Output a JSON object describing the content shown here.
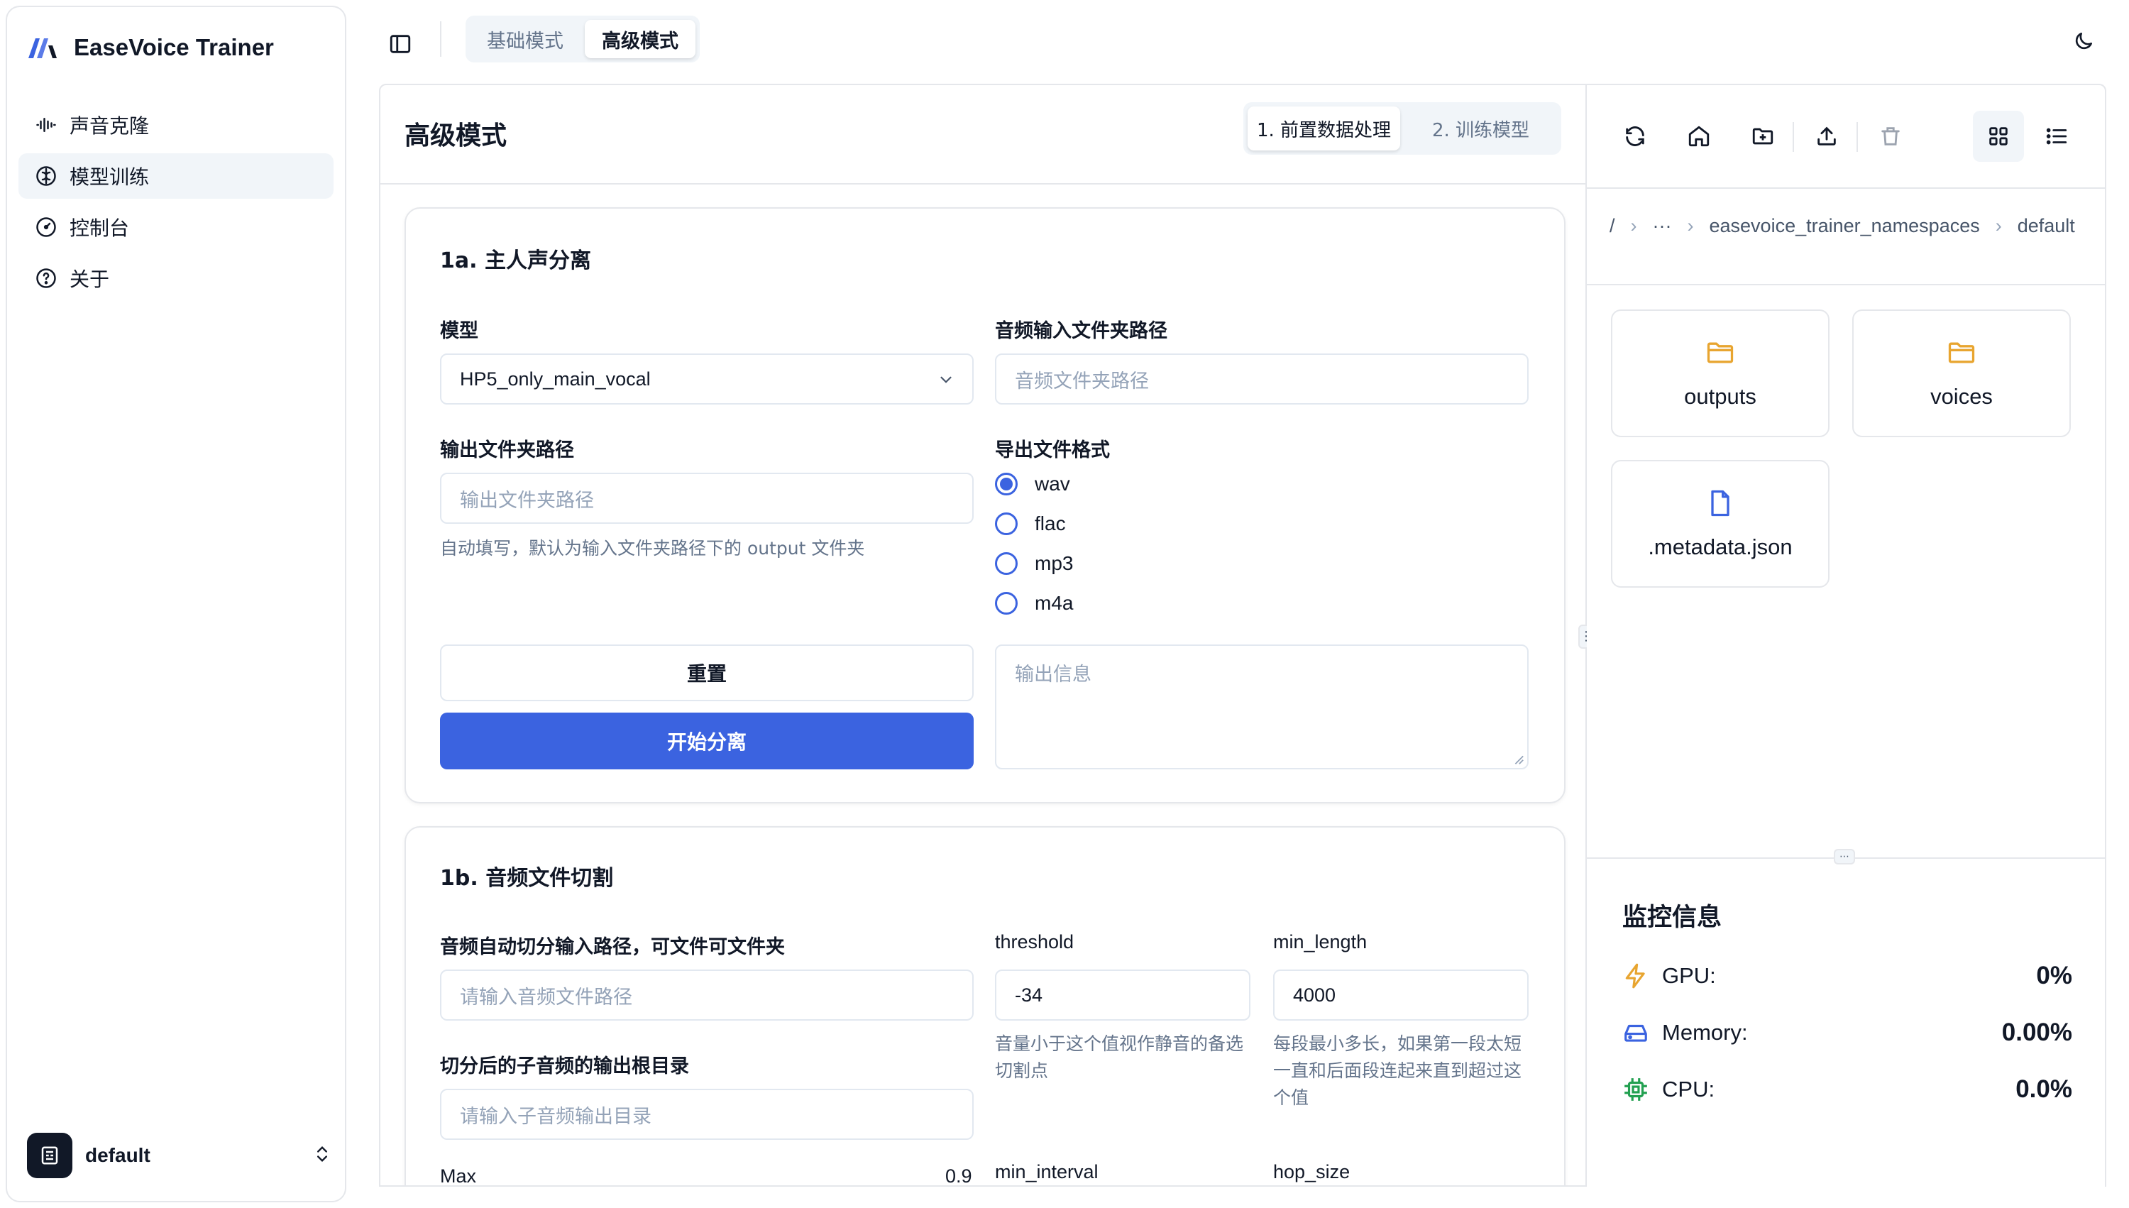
{
  "app": {
    "name": "EaseVoice Trainer"
  },
  "sidebar": {
    "items": [
      {
        "label": "声音克隆",
        "icon": "audio-waveform-icon",
        "active": false
      },
      {
        "label": "模型训练",
        "icon": "brain-icon",
        "active": true
      },
      {
        "label": "控制台",
        "icon": "gauge-icon",
        "active": false
      },
      {
        "label": "关于",
        "icon": "help-circle-icon",
        "active": false
      }
    ],
    "namespace": "default"
  },
  "topbar": {
    "mode_tabs": [
      {
        "label": "基础模式",
        "active": false
      },
      {
        "label": "高级模式",
        "active": true
      }
    ]
  },
  "main": {
    "title": "高级模式",
    "step_tabs": [
      {
        "label": "1. 前置数据处理",
        "active": true
      },
      {
        "label": "2. 训练模型",
        "active": false
      }
    ],
    "separation": {
      "title": "1a. 主人声分离",
      "model_label": "模型",
      "model_value": "HP5_only_main_vocal",
      "input_label": "音频输入文件夹路径",
      "input_placeholder": "音频文件夹路径",
      "output_label": "输出文件夹路径",
      "output_placeholder": "输出文件夹路径",
      "output_hint": "自动填写，默认为输入文件夹路径下的 output 文件夹",
      "format_label": "导出文件格式",
      "formats": [
        "wav",
        "flac",
        "mp3",
        "m4a"
      ],
      "selected_format": "wav",
      "reset_label": "重置",
      "start_label": "开始分离",
      "output_info_placeholder": "输出信息"
    },
    "slicing": {
      "title": "1b. 音频文件切割",
      "input_label": "音频自动切分输入路径，可文件可文件夹",
      "input_placeholder": "请输入音频文件路径",
      "output_label": "切分后的子音频的输出根目录",
      "output_placeholder": "请输入子音频输出目录",
      "threshold_label": "threshold",
      "threshold_value": "-34",
      "threshold_hint_1": "音量小于这个值视作静音的备选",
      "threshold_hint_2": "切割点",
      "min_length_label": "min_length",
      "min_length_value": "4000",
      "min_length_hint_1": "每段最小多长，如果第一段太短",
      "min_length_hint_2": "一直和后面段连起来直到超过这",
      "min_length_hint_3": "个值",
      "max_label": "Max",
      "max_value": "0.9",
      "min_interval_label": "min_interval",
      "hop_size_label": "hop_size"
    }
  },
  "file_manager": {
    "toolbar": [
      "refresh-icon",
      "home-icon",
      "folder-plus-icon",
      "upload-icon",
      "trash-icon",
      "grid-view-icon",
      "list-view-icon"
    ],
    "breadcrumb": [
      "/",
      "···",
      "easevoice_trainer_namespaces",
      "default"
    ],
    "items": [
      {
        "name": "outputs",
        "type": "folder"
      },
      {
        "name": "voices",
        "type": "folder"
      },
      {
        "name": ".metadata.json",
        "type": "file"
      }
    ]
  },
  "monitor": {
    "title": "监控信息",
    "rows": [
      {
        "label": "GPU:",
        "value": "0%",
        "icon": "zap-icon"
      },
      {
        "label": "Memory:",
        "value": "0.00%",
        "icon": "hard-drive-icon"
      },
      {
        "label": "CPU:",
        "value": "0.0%",
        "icon": "cpu-icon"
      }
    ]
  },
  "colors": {
    "accent": "#3b63e0",
    "folder": "#e8a530",
    "file": "#3b63e0",
    "gpu": "#e8a530",
    "memory": "#3b63e0",
    "cpu": "#22a050"
  }
}
